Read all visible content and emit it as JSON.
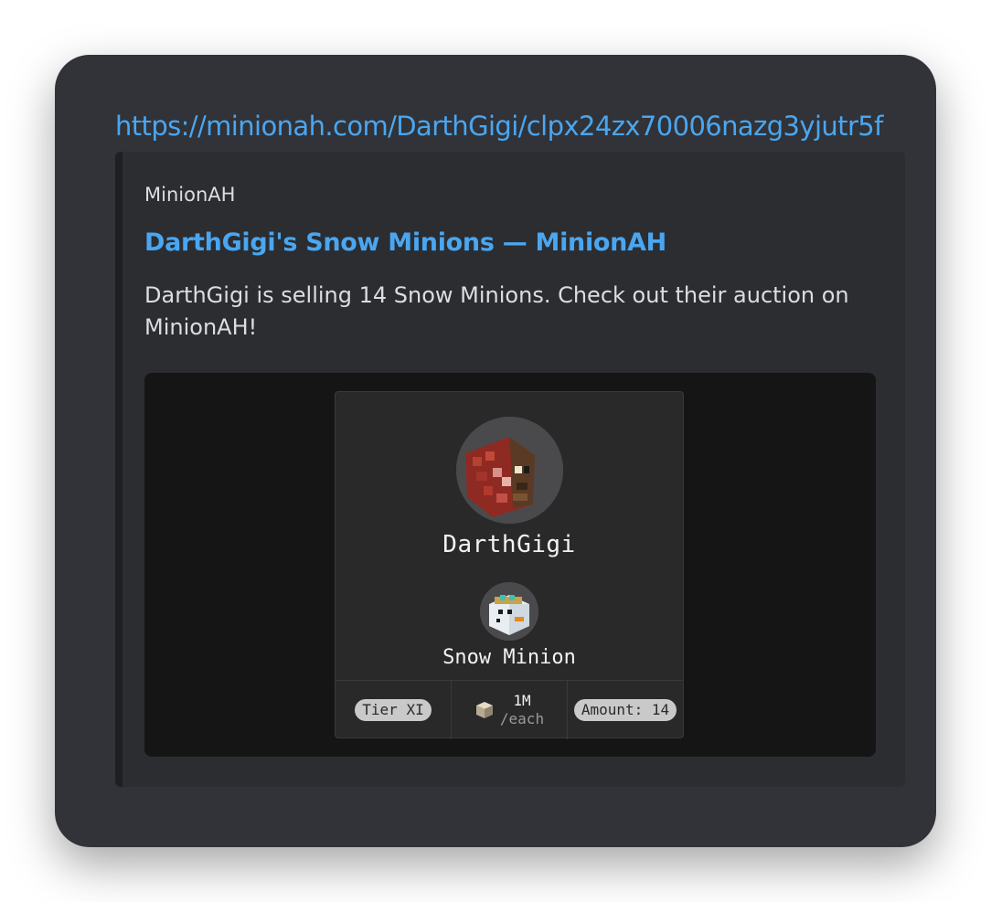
{
  "message": {
    "link": "https://minionah.com/DarthGigi/clpx24zx70006nazg3yjutr5f"
  },
  "embed": {
    "provider": "MinionAH",
    "title": "DarthGigi's Snow Minions — MinionAH",
    "description": "DarthGigi is selling 14 Snow Minions. Check out their auction on MinionAH!",
    "card": {
      "username": "DarthGigi",
      "minion_name": "Snow Minion",
      "tier": "Tier XI",
      "price": "1M",
      "price_unit": "/each",
      "amount": "Amount: 14"
    }
  }
}
